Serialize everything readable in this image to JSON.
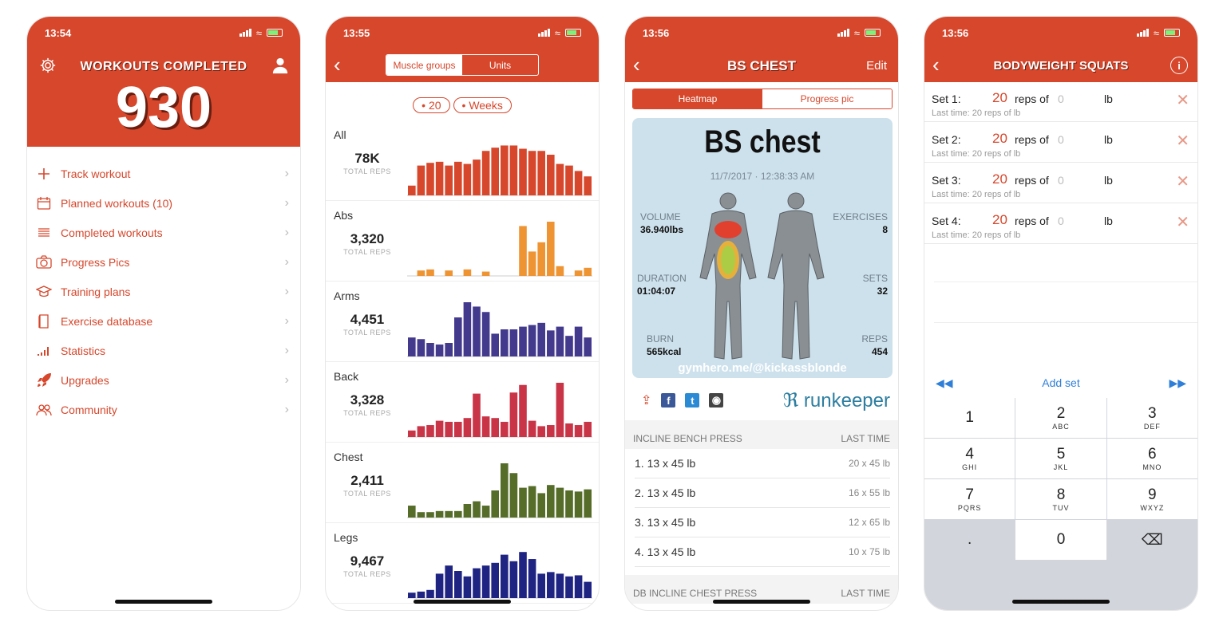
{
  "colors": {
    "accent": "#d6472c",
    "abs": "#ee9433",
    "arms": "#433a8e",
    "back": "#c93447",
    "chest": "#566d2a",
    "legs": "#1f2483",
    "link_blue": "#2f7fd8"
  },
  "phone1": {
    "time": "13:54",
    "title": "WORKOUTS COMPLETED",
    "count": "930",
    "menu": [
      {
        "label": "Track workout",
        "icon": "plus-icon"
      },
      {
        "label": "Planned workouts (10)",
        "icon": "calendar-icon"
      },
      {
        "label": "Completed workouts",
        "icon": "list-icon"
      },
      {
        "label": "Progress Pics",
        "icon": "camera-icon"
      },
      {
        "label": "Training plans",
        "icon": "graduation-cap-icon"
      },
      {
        "label": "Exercise database",
        "icon": "book-icon"
      },
      {
        "label": "Statistics",
        "icon": "bar-chart-icon"
      },
      {
        "label": "Upgrades",
        "icon": "rocket-icon"
      },
      {
        "label": "Community",
        "icon": "people-icon"
      }
    ]
  },
  "phone2": {
    "time": "13:55",
    "seg": [
      "Muscle groups",
      "Units"
    ],
    "pills": [
      "20",
      "Weeks"
    ],
    "rows": [
      {
        "name": "All",
        "value": "78K",
        "label": "TOTAL REPS"
      },
      {
        "name": "Abs",
        "value": "3,320",
        "label": "TOTAL REPS"
      },
      {
        "name": "Arms",
        "value": "4,451",
        "label": "TOTAL REPS"
      },
      {
        "name": "Back",
        "value": "3,328",
        "label": "TOTAL REPS"
      },
      {
        "name": "Chest",
        "value": "2,411",
        "label": "TOTAL REPS"
      },
      {
        "name": "Legs",
        "value": "9,467",
        "label": "TOTAL REPS"
      }
    ]
  },
  "chart_data": [
    {
      "type": "bar",
      "series": [
        {
          "values": [
            0.18,
            0.55,
            0.6,
            0.62,
            0.55,
            0.62,
            0.58,
            0.66,
            0.82,
            0.88,
            0.92,
            0.92,
            0.86,
            0.82,
            0.82,
            0.75,
            0.58,
            0.55,
            0.45,
            0.35
          ]
        }
      ]
    },
    {
      "type": "bar",
      "series": [
        {
          "values": [
            0,
            0.1,
            0.12,
            0,
            0.1,
            0,
            0.12,
            0,
            0.08,
            0,
            0,
            0,
            0.92,
            0.45,
            0.62,
            1,
            0.18,
            0,
            0.1,
            0.15
          ]
        }
      ]
    },
    {
      "type": "bar",
      "series": [
        {
          "values": [
            0.35,
            0.32,
            0.25,
            0.22,
            0.25,
            0.72,
            1,
            0.92,
            0.82,
            0.42,
            0.5,
            0.5,
            0.55,
            0.58,
            0.62,
            0.48,
            0.55,
            0.38,
            0.55,
            0.35
          ]
        }
      ]
    },
    {
      "type": "bar",
      "series": [
        {
          "values": [
            0.12,
            0.2,
            0.22,
            0.3,
            0.28,
            0.28,
            0.35,
            0.8,
            0.38,
            0.35,
            0.28,
            0.82,
            0.96,
            0.3,
            0.2,
            0.22,
            1,
            0.25,
            0.22,
            0.28
          ]
        }
      ]
    },
    {
      "type": "bar",
      "series": [
        {
          "values": [
            0.22,
            0.1,
            0.1,
            0.12,
            0.12,
            0.12,
            0.25,
            0.3,
            0.22,
            0.5,
            1,
            0.82,
            0.55,
            0.58,
            0.45,
            0.6,
            0.55,
            0.5,
            0.48,
            0.52
          ]
        }
      ]
    },
    {
      "type": "bar",
      "series": [
        {
          "values": [
            0.1,
            0.12,
            0.15,
            0.45,
            0.6,
            0.5,
            0.4,
            0.55,
            0.6,
            0.65,
            0.8,
            0.68,
            0.85,
            0.72,
            0.45,
            0.48,
            0.45,
            0.4,
            0.42,
            0.3
          ]
        }
      ]
    }
  ],
  "phone3": {
    "time": "13:56",
    "title": "BS CHEST",
    "edit": "Edit",
    "seg": [
      "Heatmap",
      "Progress pic"
    ],
    "card_title": "BS chest",
    "card_date": "11/7/2017 · 12:38:33 AM",
    "stats": {
      "volume_label": "VOLUME",
      "volume": "36.940lbs",
      "exercises_label": "EXERCISES",
      "exercises": "8",
      "duration_label": "DURATION",
      "duration": "01:04:07",
      "sets_label": "SETS",
      "sets": "32",
      "burn_label": "BURN",
      "burn": "565kcal",
      "reps_label": "REPS",
      "reps": "454"
    },
    "handle": "gymhero.me/@kickassblonde",
    "runkeeper": "runkeeper",
    "section1": {
      "title": "INCLINE BENCH PRESS",
      "right": "LAST TIME"
    },
    "exercises": [
      {
        "set": "1. 13 x 45 lb",
        "last": "20 x 45 lb"
      },
      {
        "set": "2. 13 x 45 lb",
        "last": "16 x 55 lb"
      },
      {
        "set": "3. 13 x 45 lb",
        "last": "12 x 65 lb"
      },
      {
        "set": "4. 13 x 45 lb",
        "last": "10 x 75 lb"
      }
    ],
    "section2": {
      "title": "DB INCLINE CHEST PRESS",
      "right": "LAST TIME"
    }
  },
  "phone4": {
    "time": "13:56",
    "title": "BODYWEIGHT SQUATS",
    "sets": [
      {
        "label": "Set 1:",
        "reps": "20",
        "of": "reps of",
        "weight": "0",
        "unit": "lb",
        "last": "Last time: 20 reps of lb"
      },
      {
        "label": "Set 2:",
        "reps": "20",
        "of": "reps of",
        "weight": "0",
        "unit": "lb",
        "last": "Last time: 20 reps of lb"
      },
      {
        "label": "Set 3:",
        "reps": "20",
        "of": "reps of",
        "weight": "0",
        "unit": "lb",
        "last": "Last time: 20 reps of lb"
      },
      {
        "label": "Set 4:",
        "reps": "20",
        "of": "reps of",
        "weight": "0",
        "unit": "lb",
        "last": "Last time: 20 reps of lb"
      }
    ],
    "add_set": "Add set",
    "keys": [
      {
        "n": "1",
        "l": ""
      },
      {
        "n": "2",
        "l": "ABC"
      },
      {
        "n": "3",
        "l": "DEF"
      },
      {
        "n": "4",
        "l": "GHI"
      },
      {
        "n": "5",
        "l": "JKL"
      },
      {
        "n": "6",
        "l": "MNO"
      },
      {
        "n": "7",
        "l": "PQRS"
      },
      {
        "n": "8",
        "l": "TUV"
      },
      {
        "n": "9",
        "l": "WXYZ"
      },
      {
        "n": ".",
        "l": ""
      },
      {
        "n": "0",
        "l": ""
      },
      {
        "n": "⌫",
        "l": ""
      }
    ]
  }
}
